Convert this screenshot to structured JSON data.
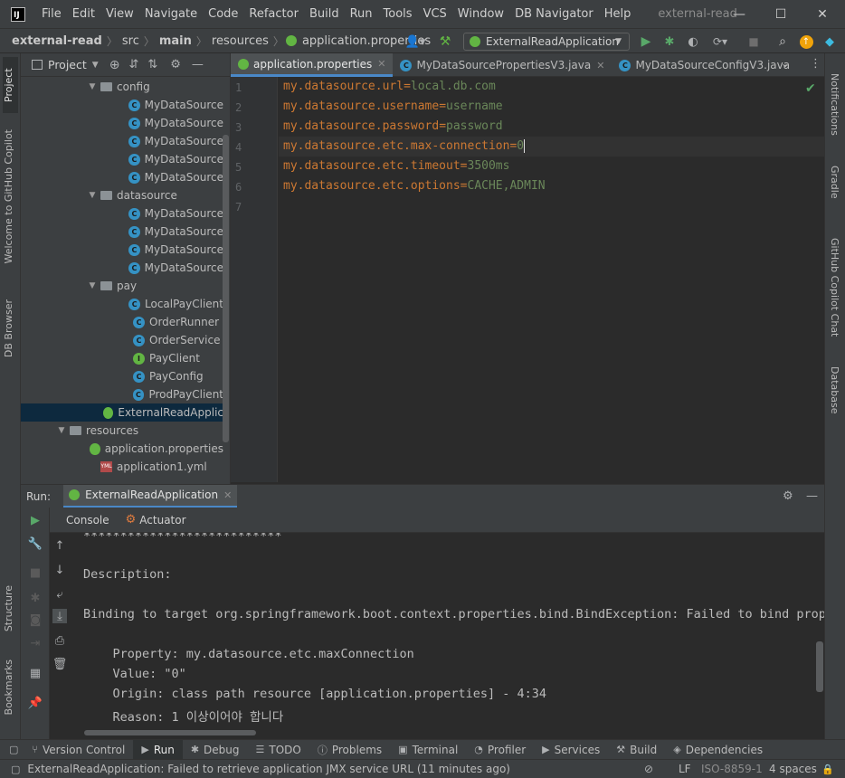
{
  "title_bar": {
    "logo": "IJ",
    "menu": [
      "File",
      "Edit",
      "View",
      "Navigate",
      "Code",
      "Refactor",
      "Build",
      "Run",
      "Tools",
      "VCS",
      "Window",
      "DB Navigator",
      "Help"
    ],
    "window_title": "external-read",
    "controls": {
      "minimize": "—",
      "maximize": "☐",
      "close": "✕"
    }
  },
  "nav_bar": {
    "breadcrumbs": [
      "external-read",
      "src",
      "main",
      "resources",
      "application.properties"
    ],
    "run_config": "ExternalReadApplication"
  },
  "left_strip": {
    "tabs": [
      "Project",
      "Welcome to GitHub Copilot",
      "DB Browser",
      "Structure",
      "Bookmarks"
    ]
  },
  "right_strip": {
    "tabs": [
      "Notifications",
      "Gradle",
      "GitHub Copilot Chat",
      "Database"
    ]
  },
  "project_panel": {
    "title": "Project",
    "tree": [
      {
        "label": "config",
        "type": "folder"
      },
      {
        "label": "MyDataSource",
        "type": "class"
      },
      {
        "label": "MyDataSource",
        "type": "class"
      },
      {
        "label": "MyDataSource",
        "type": "class"
      },
      {
        "label": "MyDataSource",
        "type": "class"
      },
      {
        "label": "MyDataSource",
        "type": "class"
      },
      {
        "label": "datasource",
        "type": "folder"
      },
      {
        "label": "MyDataSource",
        "type": "class"
      },
      {
        "label": "MyDataSource",
        "type": "class"
      },
      {
        "label": "MyDataSource",
        "type": "class"
      },
      {
        "label": "MyDataSource",
        "type": "class"
      },
      {
        "label": "pay",
        "type": "folder"
      },
      {
        "label": "LocalPayClient",
        "type": "class"
      },
      {
        "label": "OrderRunner",
        "type": "class"
      },
      {
        "label": "OrderService",
        "type": "class"
      },
      {
        "label": "PayClient",
        "type": "interface"
      },
      {
        "label": "PayConfig",
        "type": "class"
      },
      {
        "label": "ProdPayClient",
        "type": "class"
      },
      {
        "label": "ExternalReadApplic",
        "type": "spring-class"
      },
      {
        "label": "resources",
        "type": "folder"
      },
      {
        "label": "application.properties",
        "type": "properties"
      },
      {
        "label": "application1.yml",
        "type": "yaml"
      }
    ]
  },
  "editor": {
    "tabs": [
      {
        "label": "application.properties",
        "active": true
      },
      {
        "label": "MyDataSourcePropertiesV3.java",
        "active": false
      },
      {
        "label": "MyDataSourceConfigV3.java",
        "active": false
      }
    ],
    "line_numbers": [
      "1",
      "2",
      "3",
      "4",
      "5",
      "6",
      "7"
    ],
    "lines": [
      {
        "key": "my.datasource.url",
        "value": "local.db.com"
      },
      {
        "key": "my.datasource.username",
        "value": "username"
      },
      {
        "key": "my.datasource.password",
        "value": "password"
      },
      {
        "key": "my.datasource.etc.max-connection",
        "value": "0"
      },
      {
        "key": "my.datasource.etc.timeout",
        "value": "3500ms"
      },
      {
        "key": "my.datasource.etc.options",
        "value": "CACHE,ADMIN"
      }
    ],
    "equals": "="
  },
  "run_panel": {
    "label": "Run:",
    "config_tab": "ExternalReadApplication",
    "subtabs": [
      "Console",
      "Actuator"
    ],
    "console_lines": [
      "***************************",
      "Description:",
      "Binding to target org.springframework.boot.context.properties.bind.BindException: Failed to bind properties",
      "    Property: my.datasource.etc.maxConnection",
      "    Value: \"0\"",
      "    Origin: class path resource [application.properties] - 4:34",
      "    Reason: 1 이상이어야 합니다"
    ]
  },
  "bottom_tools": [
    "Version Control",
    "Run",
    "Debug",
    "TODO",
    "Problems",
    "Terminal",
    "Profiler",
    "Services",
    "Build",
    "Dependencies"
  ],
  "status_bar": {
    "message": "ExternalReadApplication: Failed to retrieve application JMX service URL (11 minutes ago)",
    "line_sep": "LF",
    "encoding": "ISO-8859-1",
    "indent": "4 spaces"
  }
}
